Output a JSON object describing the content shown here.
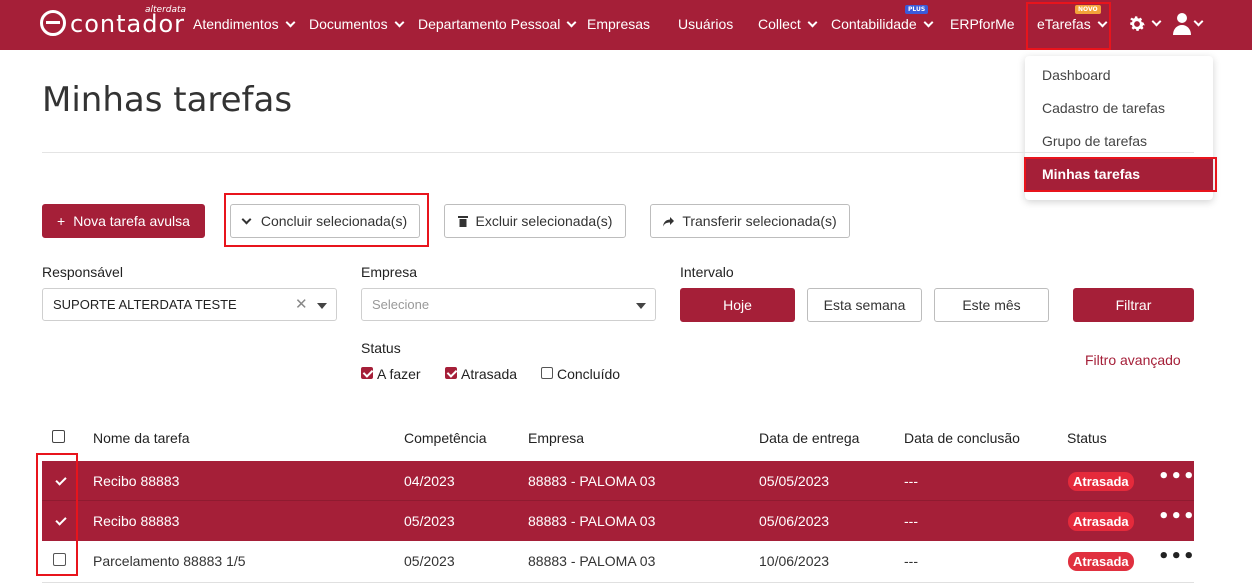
{
  "colors": {
    "brand": "#a51f38",
    "status_late": "#e0303f",
    "highlight_box": "#e8141c"
  },
  "navbar": {
    "logo_text": "contador",
    "logo_sub": "alterdata",
    "items": [
      {
        "label": "Atendimentos"
      },
      {
        "label": "Documentos"
      },
      {
        "label": "Departamento Pessoal"
      },
      {
        "label": "Empresas"
      },
      {
        "label": "Usuários"
      },
      {
        "label": "Collect"
      },
      {
        "label": "Contabilidade",
        "badge": "PLUS"
      },
      {
        "label": "ERPforMe"
      },
      {
        "label": "eTarefas",
        "badge": "NOVO"
      }
    ],
    "icons": {
      "settings": "gear-icon",
      "user": "user-icon"
    }
  },
  "dropdown": {
    "items": [
      {
        "label": "Dashboard"
      },
      {
        "label": "Cadastro de tarefas"
      },
      {
        "label": "Grupo de tarefas"
      },
      {
        "label": "Minhas tarefas",
        "active": true
      }
    ]
  },
  "page": {
    "title": "Minhas tarefas"
  },
  "toolbar": {
    "new_task": "Nova tarefa avulsa",
    "complete": "Concluir selecionada(s)",
    "delete": "Excluir selecionada(s)",
    "transfer": "Transferir selecionada(s)"
  },
  "filters": {
    "responsavel_label": "Responsável",
    "responsavel_value": "SUPORTE ALTERDATA TESTE",
    "empresa_label": "Empresa",
    "empresa_placeholder": "Selecione",
    "intervalo_label": "Intervalo",
    "intervalo_options": [
      "Hoje",
      "Esta semana",
      "Este mês"
    ],
    "intervalo_selected": "Hoje",
    "filter_button": "Filtrar",
    "status_label": "Status",
    "status_options": [
      {
        "label": "A fazer",
        "checked": true
      },
      {
        "label": "Atrasada",
        "checked": true
      },
      {
        "label": "Concluído",
        "checked": false
      }
    ],
    "advanced_link": "Filtro avançado"
  },
  "table": {
    "columns": [
      "Nome da tarefa",
      "Competência",
      "Empresa",
      "Data de entrega",
      "Data de conclusão",
      "Status"
    ],
    "rows": [
      {
        "selected": true,
        "name": "Recibo 88883",
        "competencia": "04/2023",
        "empresa": "88883 - PALOMA 03",
        "entrega": "05/05/2023",
        "conclusao": "---",
        "status": "Atrasada"
      },
      {
        "selected": true,
        "name": "Recibo 88883",
        "competencia": "05/2023",
        "empresa": "88883 - PALOMA 03",
        "entrega": "05/06/2023",
        "conclusao": "---",
        "status": "Atrasada"
      },
      {
        "selected": false,
        "name": "Parcelamento 88883 1/5",
        "competencia": "05/2023",
        "empresa": "88883 - PALOMA 03",
        "entrega": "10/06/2023",
        "conclusao": "---",
        "status": "Atrasada"
      }
    ],
    "more_symbol": "•••"
  }
}
